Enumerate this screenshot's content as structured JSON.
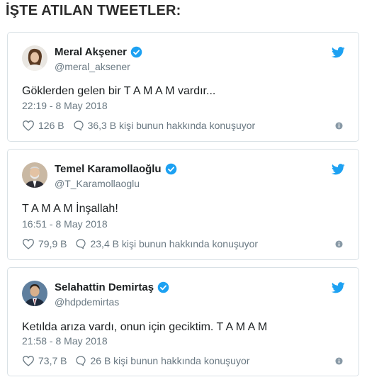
{
  "page": {
    "heading": "İŞTE ATILAN TWEETLER:"
  },
  "colors": {
    "twitter_blue": "#1da1f2",
    "text": "#1c2022",
    "muted": "#697882",
    "border": "#d9e1e6"
  },
  "tweets": [
    {
      "name": "Meral Akşener",
      "handle": "@meral_aksener",
      "text": "Göklerden gelen bir T A M A M vardır...",
      "time": "22:19 - 8 May 2018",
      "likes": "126 B",
      "talking": "36,3 B kişi bunun hakkında konuşuyor"
    },
    {
      "name": "Temel Karamollaoğlu",
      "handle": "@T_Karamollaoglu",
      "text": "T A M A M İnşallah!",
      "time": "16:51 - 8 May 2018",
      "likes": "79,9 B",
      "talking": "23,4 B kişi bunun hakkında konuşuyor"
    },
    {
      "name": "Selahattin Demirtaş",
      "handle": "@hdpdemirtas",
      "text": "Ketılda arıza vardı, onun için geciktim. T A M A M",
      "time": "21:58 - 8 May 2018",
      "likes": "73,7 B",
      "talking": "26 B kişi bunun hakkında konuşuyor"
    }
  ]
}
